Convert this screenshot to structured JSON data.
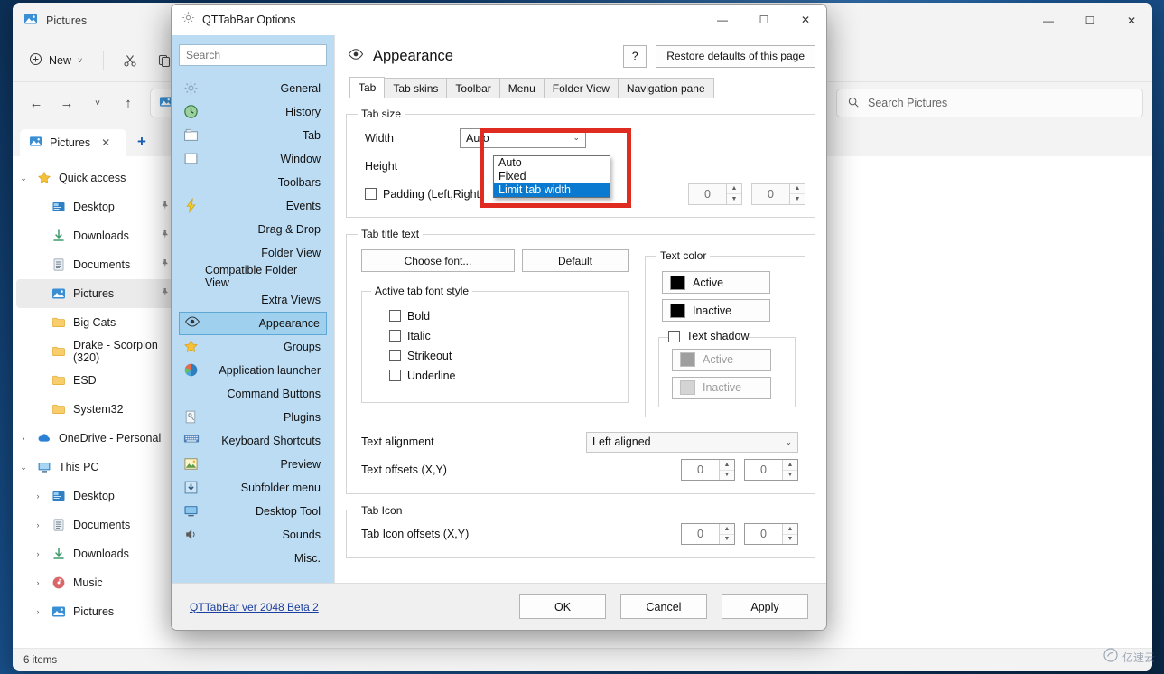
{
  "desktop": {
    "bg_color": "#14467c"
  },
  "explorer": {
    "title": "Pictures",
    "window_controls": {
      "minimize": "—",
      "maximize": "☐",
      "close": "✕"
    },
    "toolbar": {
      "new_label": "New",
      "new_caret": "˅",
      "cut_icon": "scissors-icon",
      "copy_icon": "copy-icon"
    },
    "nav": {
      "back": "←",
      "forward": "→",
      "recent": "˅",
      "up": "↑",
      "breadcrumb_text": "›",
      "search_placeholder": "Search Pictures"
    },
    "tabs": [
      {
        "label": "Pictures",
        "close": "✕"
      }
    ],
    "new_tab_label": "+",
    "tree": [
      {
        "label": "Quick access",
        "chev": "⌄",
        "icon": "star-icon",
        "indent": 0,
        "selected": false,
        "pin": ""
      },
      {
        "label": "Desktop",
        "chev": "",
        "icon": "desktop-icon",
        "indent": 1,
        "selected": false,
        "pin": "📌"
      },
      {
        "label": "Downloads",
        "chev": "",
        "icon": "download-icon",
        "indent": 1,
        "selected": false,
        "pin": "📌"
      },
      {
        "label": "Documents",
        "chev": "",
        "icon": "documents-icon",
        "indent": 1,
        "selected": false,
        "pin": "📌"
      },
      {
        "label": "Pictures",
        "chev": "",
        "icon": "pictures-icon",
        "indent": 1,
        "selected": true,
        "pin": "📌"
      },
      {
        "label": "Big Cats",
        "chev": "",
        "icon": "folder-icon",
        "indent": 1,
        "selected": false,
        "pin": ""
      },
      {
        "label": "Drake - Scorpion (320)",
        "chev": "",
        "icon": "folder-icon",
        "indent": 1,
        "selected": false,
        "pin": ""
      },
      {
        "label": "ESD",
        "chev": "",
        "icon": "folder-icon",
        "indent": 1,
        "selected": false,
        "pin": ""
      },
      {
        "label": "System32",
        "chev": "",
        "icon": "folder-icon",
        "indent": 1,
        "selected": false,
        "pin": ""
      },
      {
        "label": "OneDrive - Personal",
        "chev": "›",
        "icon": "cloud-icon",
        "indent": 0,
        "selected": false,
        "pin": ""
      },
      {
        "label": "This PC",
        "chev": "⌄",
        "icon": "pc-icon",
        "indent": 0,
        "selected": false,
        "pin": ""
      },
      {
        "label": "Desktop",
        "chev": "›",
        "icon": "desktop-icon",
        "indent": 1,
        "selected": false,
        "pin": ""
      },
      {
        "label": "Documents",
        "chev": "›",
        "icon": "documents-icon",
        "indent": 1,
        "selected": false,
        "pin": ""
      },
      {
        "label": "Downloads",
        "chev": "›",
        "icon": "download-icon",
        "indent": 1,
        "selected": false,
        "pin": ""
      },
      {
        "label": "Music",
        "chev": "›",
        "icon": "music-icon",
        "indent": 1,
        "selected": false,
        "pin": ""
      },
      {
        "label": "Pictures",
        "chev": "›",
        "icon": "pictures-icon",
        "indent": 1,
        "selected": false,
        "pin": ""
      }
    ],
    "status": "6 items"
  },
  "dialog": {
    "title": "QTTabBar Options",
    "title_icon": "gear-icon",
    "window_controls": {
      "minimize": "—",
      "maximize": "☐",
      "close": "✕"
    },
    "sidebar": {
      "search_placeholder": "Search",
      "items": [
        {
          "label": "General",
          "icon": "gear-icon",
          "selected": false
        },
        {
          "label": "History",
          "icon": "history-icon",
          "selected": false
        },
        {
          "label": "Tab",
          "icon": "tab-icon",
          "selected": false
        },
        {
          "label": "Window",
          "icon": "window-icon",
          "selected": false
        },
        {
          "label": "Toolbars",
          "icon": "",
          "selected": false
        },
        {
          "label": "Events",
          "icon": "bolt-icon",
          "selected": false
        },
        {
          "label": "Drag & Drop",
          "icon": "",
          "selected": false
        },
        {
          "label": "Folder View",
          "icon": "",
          "selected": false
        },
        {
          "label": "Compatible Folder View",
          "icon": "",
          "selected": false
        },
        {
          "label": "Extra Views",
          "icon": "",
          "selected": false
        },
        {
          "label": "Appearance",
          "icon": "eye-icon",
          "selected": true
        },
        {
          "label": "Groups",
          "icon": "star-icon",
          "selected": false
        },
        {
          "label": "Application launcher",
          "icon": "launcher-icon",
          "selected": false
        },
        {
          "label": "Command Buttons",
          "icon": "",
          "selected": false
        },
        {
          "label": "Plugins",
          "icon": "plugin-icon",
          "selected": false
        },
        {
          "label": "Keyboard Shortcuts",
          "icon": "keyboard-icon",
          "selected": false
        },
        {
          "label": "Preview",
          "icon": "preview-icon",
          "selected": false
        },
        {
          "label": "Subfolder menu",
          "icon": "subfolder-icon",
          "selected": false
        },
        {
          "label": "Desktop Tool",
          "icon": "monitor-icon",
          "selected": false
        },
        {
          "label": "Sounds",
          "icon": "speaker-icon",
          "selected": false
        },
        {
          "label": "Misc.",
          "icon": "",
          "selected": false
        }
      ]
    },
    "page": {
      "title": "Appearance",
      "title_icon": "eye-icon",
      "help_label": "?",
      "restore_label": "Restore defaults of this page",
      "tabs": [
        {
          "label": "Tab",
          "active": true
        },
        {
          "label": "Tab skins",
          "active": false
        },
        {
          "label": "Toolbar",
          "active": false
        },
        {
          "label": "Menu",
          "active": false
        },
        {
          "label": "Folder View",
          "active": false
        },
        {
          "label": "Navigation pane",
          "active": false
        }
      ],
      "tab_size": {
        "legend": "Tab size",
        "width_label": "Width",
        "height_label": "Height",
        "width_value": "Auto",
        "combo_caret": "⌄",
        "dropdown_options": [
          {
            "label": "Auto",
            "selected": false
          },
          {
            "label": "Fixed",
            "selected": false
          },
          {
            "label": "Limit tab width",
            "selected": true
          }
        ],
        "padding_label": "Padding (Left,Right)",
        "padding_checked": false,
        "padding_x": "0",
        "padding_y": "0"
      },
      "tab_title_text": {
        "legend": "Tab title text",
        "choose_font_label": "Choose font...",
        "default_label": "Default",
        "font_style": {
          "legend": "Active tab font style",
          "items": [
            {
              "label": "Bold",
              "checked": false
            },
            {
              "label": "Italic",
              "checked": false
            },
            {
              "label": "Strikeout",
              "checked": false
            },
            {
              "label": "Underline",
              "checked": false
            }
          ]
        },
        "text_color": {
          "legend": "Text color",
          "active_label": "Active",
          "active_color": "#000000",
          "inactive_label": "Inactive",
          "inactive_color": "#000000",
          "shadow_label": "Text shadow",
          "shadow_checked": false,
          "shadow_active_label": "Active",
          "shadow_active_color": "#9e9e9e",
          "shadow_inactive_label": "Inactive",
          "shadow_inactive_color": "#d4d4d4"
        },
        "alignment_label": "Text alignment",
        "alignment_value": "Left aligned",
        "offsets_label": "Text offsets (X,Y)",
        "offset_x": "0",
        "offset_y": "0"
      },
      "tab_icon": {
        "legend": "Tab Icon",
        "offsets_label": "Tab Icon offsets (X,Y)",
        "offset_x": "0",
        "offset_y": "0"
      }
    },
    "footer": {
      "version_link": "QTTabBar ver 2048 Beta 2",
      "ok_label": "OK",
      "cancel_label": "Cancel",
      "apply_label": "Apply"
    },
    "highlight_color": "#e02b20"
  },
  "watermark": {
    "text": "亿速云"
  }
}
